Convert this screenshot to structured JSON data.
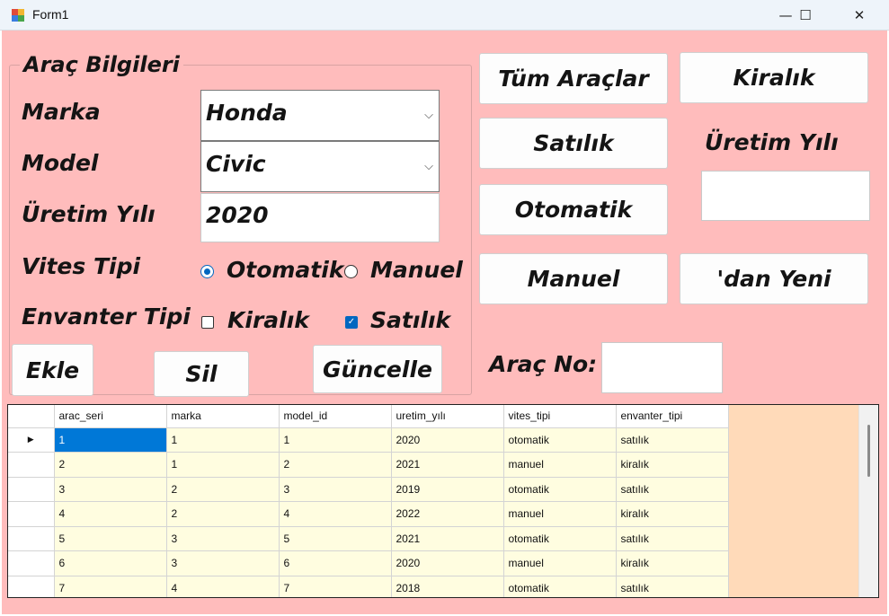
{
  "window": {
    "title": "Form1",
    "minimize": "—",
    "maximize": "☐",
    "close": "✕"
  },
  "group": {
    "title": "Araç Bilgileri",
    "marka_label": "Marka",
    "model_label": "Model",
    "uretim_label": "Üretim Yılı",
    "vites_label": "Vites Tipi",
    "envanter_label": "Envanter Tipi",
    "marka_value": "Honda",
    "model_value": "Civic",
    "uretim_value": "2020",
    "vites_options": [
      {
        "label": "Otomatik",
        "selected": true
      },
      {
        "label": "Manuel",
        "selected": false
      }
    ],
    "envanter_options": [
      {
        "label": "Kiralık",
        "checked": false
      },
      {
        "label": "Satılık",
        "checked": true
      }
    ]
  },
  "actions": {
    "ekle": "Ekle",
    "sil": "Sil",
    "guncelle": "Güncelle"
  },
  "filters": {
    "tum": "Tüm Araçlar",
    "kiralik": "Kiralık",
    "satilik": "Satılık",
    "uretim_label": "Üretim Yılı",
    "uretim_value": "",
    "otomatik": "Otomatik",
    "manuel": "Manuel",
    "dan_yeni": "'dan Yeni",
    "arac_no_label": "Araç No:",
    "arac_no_value": ""
  },
  "grid": {
    "columns": [
      "arac_seri",
      "marka",
      "model_id",
      "uretim_yılı",
      "vites_tipi",
      "envanter_tipi"
    ],
    "rows": [
      [
        "1",
        "1",
        "1",
        "2020",
        "otomatik",
        "satılık"
      ],
      [
        "2",
        "1",
        "2",
        "2021",
        "manuel",
        "kiralık"
      ],
      [
        "3",
        "2",
        "3",
        "2019",
        "otomatik",
        "satılık"
      ],
      [
        "4",
        "2",
        "4",
        "2022",
        "manuel",
        "kiralık"
      ],
      [
        "5",
        "3",
        "5",
        "2021",
        "otomatik",
        "satılık"
      ],
      [
        "6",
        "3",
        "6",
        "2020",
        "manuel",
        "kiralık"
      ],
      [
        "7",
        "4",
        "7",
        "2018",
        "otomatik",
        "satılık"
      ]
    ],
    "current_row_marker": "▶"
  },
  "colors": {
    "form_background": "#ffbcbc",
    "grid_background": "#ffdab9",
    "cell_background": "#fffde0",
    "selection": "#0078d7"
  }
}
